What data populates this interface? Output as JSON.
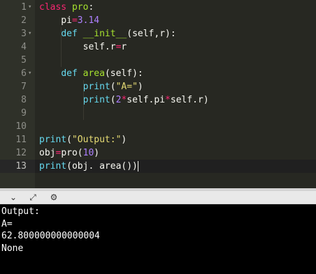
{
  "editor": {
    "line_numbers": [
      "1",
      "2",
      "3",
      "4",
      "5",
      "6",
      "7",
      "8",
      "9",
      "10",
      "11",
      "12",
      "13"
    ],
    "fold_markers": {
      "0": "▾",
      "2": "▾",
      "5": "▾"
    },
    "lines": [
      [
        {
          "t": "class ",
          "c": "kw"
        },
        {
          "t": "pro",
          "c": "fn"
        },
        {
          "t": ":",
          "c": "plain"
        }
      ],
      [
        {
          "t": "    pi",
          "c": "plain"
        },
        {
          "t": "=",
          "c": "op"
        },
        {
          "t": "3.14",
          "c": "n"
        }
      ],
      [
        {
          "t": "    ",
          "c": "plain"
        },
        {
          "t": "def ",
          "c": "def"
        },
        {
          "t": "__init__",
          "c": "fn"
        },
        {
          "t": "(self,r):",
          "c": "plain"
        }
      ],
      [
        {
          "t": "        self.r",
          "c": "plain"
        },
        {
          "t": "=",
          "c": "op"
        },
        {
          "t": "r",
          "c": "plain"
        }
      ],
      [],
      [
        {
          "t": "    ",
          "c": "plain"
        },
        {
          "t": "def ",
          "c": "def"
        },
        {
          "t": "area",
          "c": "fn"
        },
        {
          "t": "(self):",
          "c": "plain"
        }
      ],
      [
        {
          "t": "        ",
          "c": "plain"
        },
        {
          "t": "print",
          "c": "bi"
        },
        {
          "t": "(",
          "c": "plain"
        },
        {
          "t": "\"A=\"",
          "c": "str"
        },
        {
          "t": ")",
          "c": "plain"
        }
      ],
      [
        {
          "t": "        ",
          "c": "plain"
        },
        {
          "t": "print",
          "c": "bi"
        },
        {
          "t": "(",
          "c": "plain"
        },
        {
          "t": "2",
          "c": "n"
        },
        {
          "t": "*",
          "c": "op"
        },
        {
          "t": "self.pi",
          "c": "plain"
        },
        {
          "t": "*",
          "c": "op"
        },
        {
          "t": "self.r)",
          "c": "plain"
        }
      ],
      [],
      [],
      [
        {
          "t": "print",
          "c": "bi"
        },
        {
          "t": "(",
          "c": "plain"
        },
        {
          "t": "\"Output:\"",
          "c": "str"
        },
        {
          "t": ")",
          "c": "plain"
        }
      ],
      [
        {
          "t": "obj",
          "c": "plain"
        },
        {
          "t": "=",
          "c": "op"
        },
        {
          "t": "pro(",
          "c": "plain"
        },
        {
          "t": "10",
          "c": "n"
        },
        {
          "t": ")",
          "c": "plain"
        }
      ],
      [
        {
          "t": "print",
          "c": "bi"
        },
        {
          "t": "(",
          "c": "plain"
        },
        {
          "t": "obj. area())",
          "c": "plain"
        }
      ]
    ],
    "active_line": 12
  },
  "toolbar": {
    "collapse_icon": "chevron-down-icon",
    "expand_icon": "expand-arrows-icon",
    "settings_icon": "settings-icon",
    "collapse_glyph": "⌄",
    "expand_glyph": "⤢",
    "settings_glyph": "⚙"
  },
  "output": {
    "lines": [
      "Output:",
      "A=",
      "62.800000000000004",
      "None"
    ]
  },
  "colors": {
    "editor_bg": "#272822",
    "gutter_bg": "#2f3129",
    "keyword": "#f92672",
    "function": "#a6e22e",
    "number": "#ae81ff",
    "string": "#e6db74",
    "builtin": "#66d9ef",
    "console_bg": "#000000",
    "console_text": "#ffffff"
  }
}
